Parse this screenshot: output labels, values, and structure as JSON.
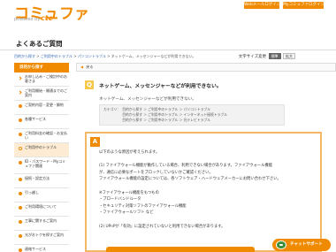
{
  "header": {
    "logo_text": "コミュファ",
    "logo_sub": "powered by",
    "logo_brand": "ctc",
    "btn_web_mail": "Webメールログイン",
    "btn_my_commufa": "Myコミュファログイン"
  },
  "page": {
    "title": "よくあるご質問"
  },
  "breadcrumb": {
    "items": [
      "目的から探す",
      "ご利用中のトラブル",
      "パソコントラブル",
      "ネットゲーム、メッセンジャーなどが利用できない。"
    ],
    "separator": ">"
  },
  "font_size": {
    "label": "文字サイズ変更",
    "small": "標準",
    "large": "拡大"
  },
  "sidebar": {
    "heading": "目的から探す",
    "items": [
      {
        "label": "お申し込み・ご検討中のお客さま",
        "icon": "chevron-right-icon"
      },
      {
        "label": "ご利用開始・開通までのご案内",
        "icon": "chevron-right-icon"
      },
      {
        "label": "ご契約内容・変更・解約",
        "icon": "bullet-icon"
      },
      {
        "label": "各種サービス",
        "icon": "bullet-icon"
      },
      {
        "label": "ご利用料金の確認・お支払い",
        "icon": "bullet-icon"
      },
      {
        "label": "ご利用中のトラブル",
        "icon": "bullet-icon"
      },
      {
        "label": "ID・パスワード・Myコミュファ関連",
        "icon": "bullet-icon"
      },
      {
        "label": "接続・設定方法",
        "icon": "bullet-icon"
      },
      {
        "label": "引っ越し",
        "icon": "bullet-icon"
      },
      {
        "label": "ご利用環境について",
        "icon": "bullet-icon"
      },
      {
        "label": "工事に関するご案内",
        "icon": "bullet-icon"
      },
      {
        "label": "光がおトクを探すご案内",
        "icon": "bullet-icon"
      },
      {
        "label": "連絡サービス",
        "icon": "bullet-icon"
      }
    ]
  },
  "main": {
    "back_label": "戻る",
    "question_badge": "Q",
    "question": "ネットゲーム、メッセンジャーなどが利用できない。",
    "question_sub": "ネットゲーム、メッセンジャーなどが利用できない。",
    "category_label": "カテゴリ：",
    "categories": [
      "目的から探す ＞ ご利用中のトラブル ＞ パソコントラブル",
      "目的から探す ＞ ご利用中のトラブル ＞ インターネット接続トラブル",
      "目的から探す ＞ ご利用中のトラブル ＞ 光テレビトラブル"
    ],
    "answer_badge": "A",
    "answer_lines": [
      "以下のような原因が考えられます。",
      "",
      "(1) ファイアウォール機能が動作している場合、利用できない場合があります。ファイアウォール機能",
      "が、通信に必要なポートをブロックしていないかご確認ください。",
      "ファイアウォール機能の設定については、各ソフトウェア・ハードウェアメーカーにお問い合わせ下さい。",
      "",
      "※ファイアウォール機能をもつもの",
      "・ブロードバンドルータ",
      "・セキュリティ対策ソフトのファイアウォール機能",
      "・ファイアウォールソフト など",
      "",
      "(2) UPnPが「有効」に設定されていないと利用できない場合があります。"
    ]
  },
  "chat": {
    "label": "チャットサポート"
  },
  "colors": {
    "brand_orange": "#f08a00",
    "q_badge": "#f8c84a",
    "answer_border": "#f3b866"
  }
}
